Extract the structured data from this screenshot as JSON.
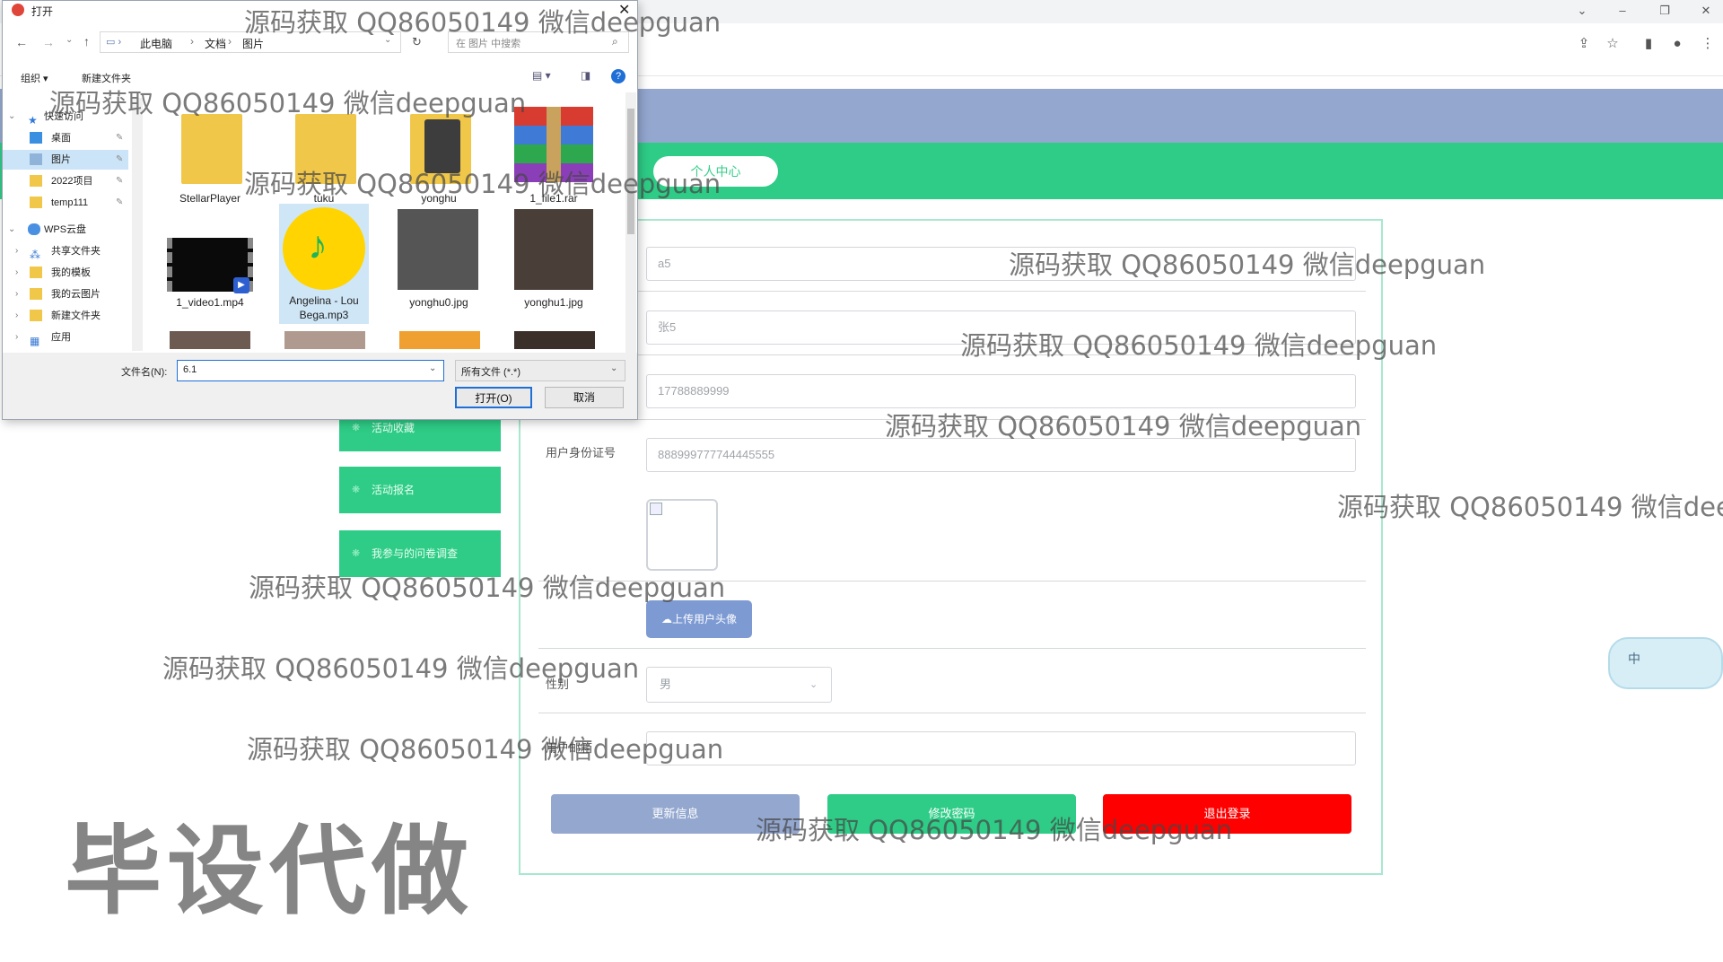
{
  "dialog": {
    "title": "打开",
    "breadcrumb": [
      "此电脑",
      "文档",
      "图片"
    ],
    "search_placeholder": "在 图片 中搜索",
    "toolbar": {
      "organize": "组织 ▾",
      "new_folder": "新建文件夹"
    },
    "tree": [
      {
        "label": "快速访问",
        "pinned": false
      },
      {
        "label": "桌面",
        "pinned": true
      },
      {
        "label": "图片",
        "pinned": true
      },
      {
        "label": "2022项目",
        "pinned": true
      },
      {
        "label": "temp111",
        "pinned": true
      },
      {
        "label": "WPS云盘",
        "pinned": false
      },
      {
        "label": "共享文件夹",
        "pinned": false
      },
      {
        "label": "我的模板",
        "pinned": false
      },
      {
        "label": "我的云图片",
        "pinned": false
      },
      {
        "label": "新建文件夹",
        "pinned": false
      },
      {
        "label": "应用",
        "pinned": false
      }
    ],
    "files": [
      {
        "name": "StellarPlayer",
        "kind": "folder"
      },
      {
        "name": "tuku",
        "kind": "folder"
      },
      {
        "name": "yonghu",
        "kind": "folder"
      },
      {
        "name": "1_file1.rar",
        "kind": "archive"
      },
      {
        "name": "1_video1.mp4",
        "kind": "video"
      },
      {
        "name": "Angelina - Lou Bega.mp3",
        "kind": "audio"
      },
      {
        "name": "yonghu0.jpg",
        "kind": "image"
      },
      {
        "name": "yonghu1.jpg",
        "kind": "image"
      }
    ],
    "filename_label": "文件名(N):",
    "filename_value": "6.1",
    "filetype_value": "所有文件 (*.*)",
    "open_button": "打开(O)",
    "cancel_button": "取消"
  },
  "nav": {
    "personal_center": "个人中心"
  },
  "sidebar": {
    "items": [
      "活动收藏",
      "活动报名",
      "我参与的问卷调查"
    ]
  },
  "form": {
    "account": "a5",
    "name": "张5",
    "phone": "17788889999",
    "id_label": "用户身份证号",
    "id_value": "888999777744445555",
    "upload_button": "上传用户头像",
    "gender_label": "性别",
    "gender_value": "男",
    "email_label": "用户邮箱",
    "email_value": "",
    "buttons": {
      "update": "更新信息",
      "change_password": "修改密码",
      "logout": "退出登录"
    }
  },
  "ime": {
    "label": "中"
  },
  "watermarks": {
    "text": "源码获取 QQ86050149 微信deepguan",
    "stamp": "毕设代做"
  },
  "colors": {
    "header_blue": "#93a7cf",
    "header_green": "#2ecc86",
    "update_button": "#93a7cf",
    "password_button": "#2ecc86",
    "logout_button": "#ff0000"
  }
}
